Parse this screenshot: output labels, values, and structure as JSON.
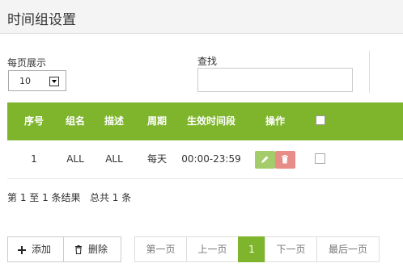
{
  "page_title": "时间组设置",
  "controls": {
    "per_page_label": "每页展示",
    "per_page_value": "10",
    "search_label": "查找",
    "search_value": ""
  },
  "table": {
    "headers": {
      "index": "序号",
      "group": "组名",
      "desc": "描述",
      "period": "周期",
      "time_range": "生效时间段",
      "actions": "操作"
    },
    "rows": [
      {
        "index": "1",
        "group": "ALL",
        "desc": "ALL",
        "period": "每天",
        "time_range": "00:00-23:59"
      }
    ]
  },
  "summary": {
    "text": "第 1 至 1 条结果   总共 1 条"
  },
  "buttons": {
    "add": "添加",
    "delete": "删除"
  },
  "pagination": {
    "first": "第一页",
    "prev": "上一页",
    "current": "1",
    "next": "下一页",
    "last": "最后一页"
  },
  "colors": {
    "accent": "#7fb52d",
    "edit": "#a5cc6b",
    "delete": "#e78c86"
  }
}
